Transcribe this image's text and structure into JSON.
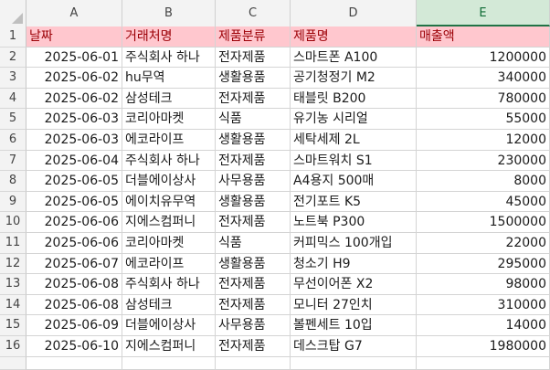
{
  "columns": [
    "A",
    "B",
    "C",
    "D",
    "E"
  ],
  "selected_column": "E",
  "header": [
    "날짜",
    "거래처명",
    "제품분류",
    "제품명",
    "매출액"
  ],
  "header_style": {
    "fill": "#ffc7ce",
    "text": "#9c0006"
  },
  "rows": [
    [
      "2025-06-01",
      "주식회사 하나",
      "전자제품",
      "스마트폰 A100",
      "1200000"
    ],
    [
      "2025-06-02",
      "hu무역",
      "생활용품",
      "공기청정기 M2",
      "340000"
    ],
    [
      "2025-06-02",
      "삼성테크",
      "전자제품",
      "태블릿 B200",
      "780000"
    ],
    [
      "2025-06-03",
      "코리아마켓",
      "식품",
      "유기농 시리얼",
      "55000"
    ],
    [
      "2025-06-03",
      "에코라이프",
      "생활용품",
      "세탁세제 2L",
      "12000"
    ],
    [
      "2025-06-04",
      "주식회사 하나",
      "전자제품",
      "스마트워치 S1",
      "230000"
    ],
    [
      "2025-06-05",
      "더블에이상사",
      "사무용품",
      "A4용지 500매",
      "8000"
    ],
    [
      "2025-06-05",
      "에이치유무역",
      "생활용품",
      "전기포트 K5",
      "45000"
    ],
    [
      "2025-06-06",
      "지에스컴퍼니",
      "전자제품",
      "노트북 P300",
      "1500000"
    ],
    [
      "2025-06-06",
      "코리아마켓",
      "식품",
      "커피믹스 100개입",
      "22000"
    ],
    [
      "2025-06-07",
      "에코라이프",
      "생활용품",
      "청소기 H9",
      "295000"
    ],
    [
      "2025-06-08",
      "주식회사 하나",
      "전자제품",
      "무선이어폰 X2",
      "98000"
    ],
    [
      "2025-06-08",
      "삼성테크",
      "전자제품",
      "모니터 27인치",
      "310000"
    ],
    [
      "2025-06-09",
      "더블에이상사",
      "사무용품",
      "볼펜세트 10입",
      "14000"
    ],
    [
      "2025-06-10",
      "지에스컴퍼니",
      "전자제품",
      "데스크탑 G7",
      "1980000"
    ]
  ],
  "row_numbers": [
    "1",
    "2",
    "3",
    "4",
    "5",
    "6",
    "7",
    "8",
    "9",
    "10",
    "11",
    "12",
    "13",
    "14",
    "15",
    "16"
  ]
}
